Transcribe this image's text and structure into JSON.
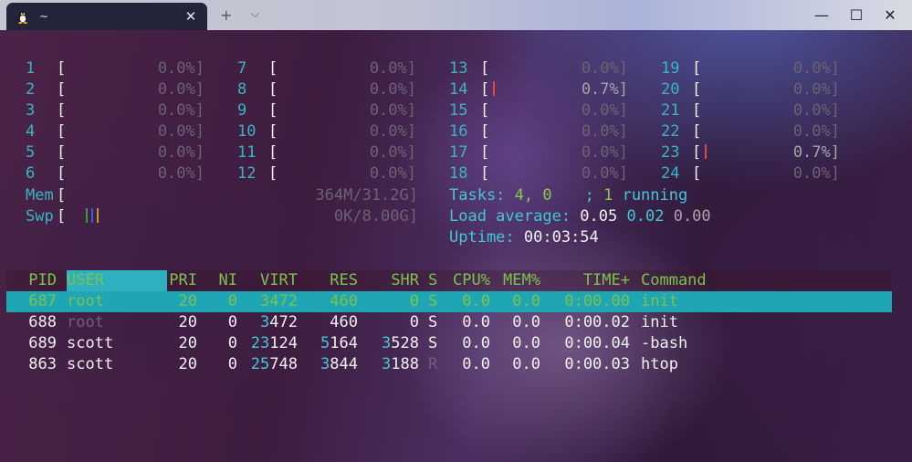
{
  "window": {
    "tab_title": "~",
    "tab_icon": "linux-penguin-icon",
    "new_tab_label": "+",
    "dropdown_label": "⌵",
    "minimize_label": "—",
    "maximize_label": "☐",
    "close_label": "✕",
    "tab_close_label": "✕"
  },
  "cpus": [
    {
      "id": "1",
      "val": "0.0%]",
      "bar": false
    },
    {
      "id": "2",
      "val": "0.0%]",
      "bar": false
    },
    {
      "id": "3",
      "val": "0.0%]",
      "bar": false
    },
    {
      "id": "4",
      "val": "0.0%]",
      "bar": false
    },
    {
      "id": "5",
      "val": "0.0%]",
      "bar": false
    },
    {
      "id": "6",
      "val": "0.0%]",
      "bar": false
    },
    {
      "id": "7",
      "val": "0.0%]",
      "bar": false
    },
    {
      "id": "8",
      "val": "0.0%]",
      "bar": false
    },
    {
      "id": "9",
      "val": "0.0%]",
      "bar": false
    },
    {
      "id": "10",
      "val": "0.0%]",
      "bar": false
    },
    {
      "id": "11",
      "val": "0.0%]",
      "bar": false
    },
    {
      "id": "12",
      "val": "0.0%]",
      "bar": false
    },
    {
      "id": "13",
      "val": "0.0%]",
      "bar": false
    },
    {
      "id": "14",
      "val": "0.7%]",
      "bar": true
    },
    {
      "id": "15",
      "val": "0.0%]",
      "bar": false
    },
    {
      "id": "16",
      "val": "0.0%]",
      "bar": false
    },
    {
      "id": "17",
      "val": "0.0%]",
      "bar": false
    },
    {
      "id": "18",
      "val": "0.0%]",
      "bar": false
    },
    {
      "id": "19",
      "val": "0.0%]",
      "bar": false
    },
    {
      "id": "20",
      "val": "0.0%]",
      "bar": false
    },
    {
      "id": "21",
      "val": "0.0%]",
      "bar": false
    },
    {
      "id": "22",
      "val": "0.0%]",
      "bar": false
    },
    {
      "id": "23",
      "val": "0.7%]",
      "bar": true
    },
    {
      "id": "24",
      "val": "0.0%]",
      "bar": false
    }
  ],
  "meters": {
    "mem_label": "Mem",
    "mem_value": "364M/31.2G]",
    "swp_label": "Swp",
    "swp_value": "0K/8.00G]",
    "open_bracket": "["
  },
  "stats": {
    "tasks_label": "Tasks: ",
    "tasks_value": "4, 0",
    "tasks_sep": "; ",
    "running_value": "1",
    "running_label": " running",
    "load_label": "Load average: ",
    "load1": "0.05",
    "load5": "0.02",
    "load15": "0.00",
    "uptime_label": "Uptime: ",
    "uptime_value": "00:03:54"
  },
  "columns": {
    "pid": "PID",
    "user": "USER",
    "pri": "PRI",
    "ni": "NI",
    "virt": "VIRT",
    "res": "RES",
    "shr": "SHR",
    "s": "S",
    "cpu": "CPU%",
    "mem": "MEM%",
    "time": "TIME+",
    "command": "Command"
  },
  "processes": [
    {
      "pid": "687",
      "user": "root",
      "pri": "20",
      "ni": "0",
      "virt": "3472",
      "res": "460",
      "shr": "0",
      "s": "S",
      "cpu": "0.0",
      "mem": "0.0",
      "time": "0:00.00",
      "command": "init"
    },
    {
      "pid": "688",
      "user": "root",
      "pri": "20",
      "ni": "0",
      "virt_a": "3",
      "virt_b": "472",
      "res": "460",
      "shr": "0",
      "s": "S",
      "cpu": "0.0",
      "mem": "0.0",
      "time": "0:00.02",
      "command": "init"
    },
    {
      "pid": "689",
      "user": "scott",
      "pri": "20",
      "ni": "0",
      "virt_a": "23",
      "virt_b": "124",
      "res_a": "5",
      "res_b": "164",
      "shr_a": "3",
      "shr_b": "528",
      "s": "S",
      "cpu": "0.0",
      "mem": "0.0",
      "time": "0:00.04",
      "command": "-bash"
    },
    {
      "pid": "863",
      "user": "scott",
      "pri": "20",
      "ni": "0",
      "virt_a": "25",
      "virt_b": "748",
      "res_a": "3",
      "res_b": "844",
      "shr_a": "3",
      "shr_b": "188",
      "s": "R",
      "cpu": "0.0",
      "mem": "0.0",
      "time": "0:00.03",
      "command": "htop"
    }
  ],
  "colors": {
    "cyan": "#41c8d6",
    "green": "#7cc24a",
    "selection": "#1fa6b4",
    "cpu_bar": "#e04848"
  }
}
